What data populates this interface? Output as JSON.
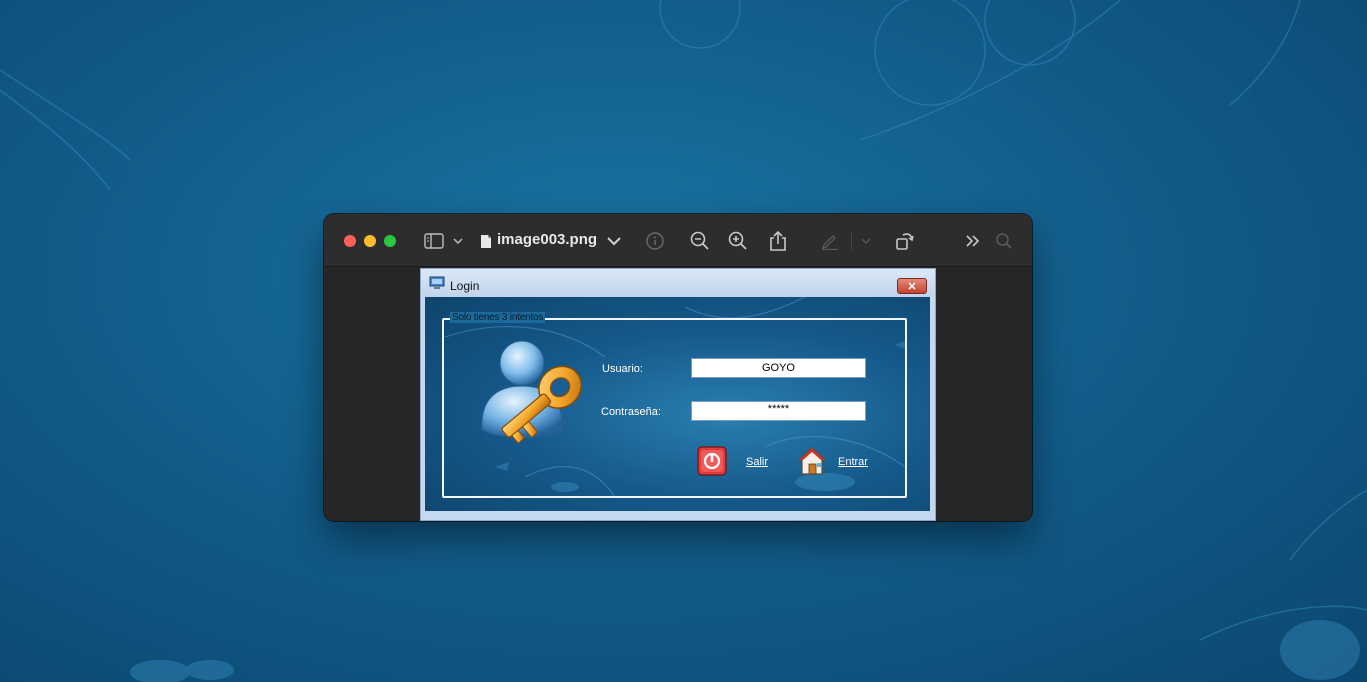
{
  "preview": {
    "document_title": "image003.png"
  },
  "dialog": {
    "title": "Login",
    "close_glyph": "✕",
    "group_label": "Solo tienes 3 intentos",
    "username_label": "Usuario:",
    "username_value": "GOYO",
    "password_label": "Contraseña:",
    "password_value": "*****",
    "exit_label": "Salir",
    "enter_label": "Entrar"
  },
  "icons": {
    "sidebar": "sidebar-toggle-icon",
    "chevron": "chevron-down-icon",
    "document": "document-icon",
    "info": "info-icon",
    "zoom_out": "zoom-out-icon",
    "zoom_in": "zoom-in-icon",
    "share": "share-icon",
    "markup": "pen-icon",
    "rotate": "rotate-icon",
    "more": "double-chevron-icon",
    "search": "search-icon",
    "power": "power-icon",
    "house": "house-icon"
  },
  "colors": {
    "close": "#fe5f57",
    "minimize": "#febc2e",
    "maximize": "#28c840",
    "desktop": "#125e8c"
  }
}
